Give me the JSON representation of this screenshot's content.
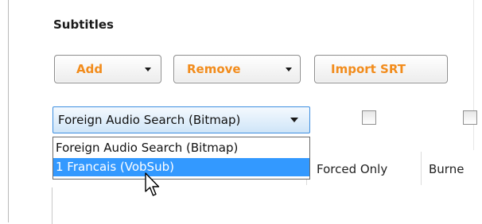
{
  "section": {
    "title": "Subtitles"
  },
  "toolbar": {
    "add_label": "Add",
    "remove_label": "Remove",
    "import_label": "Import SRT"
  },
  "track": {
    "selected": "Foreign Audio Search (Bitmap)",
    "options": [
      "Foreign Audio Search (Bitmap)",
      "1 Francais (VobSub)"
    ],
    "highlighted_index": 1
  },
  "grid": {
    "columns": [
      "Forced Only",
      "Burne"
    ]
  },
  "colors": {
    "button_text": "#f28c1c",
    "highlight": "#3399ff",
    "combo_border": "#3d8ee0"
  },
  "icons": {
    "add_dropdown": "chevron-down-icon",
    "remove_dropdown": "chevron-down-icon",
    "combo_dropdown": "chevron-down-icon",
    "cursor": "mouse-pointer-icon"
  }
}
